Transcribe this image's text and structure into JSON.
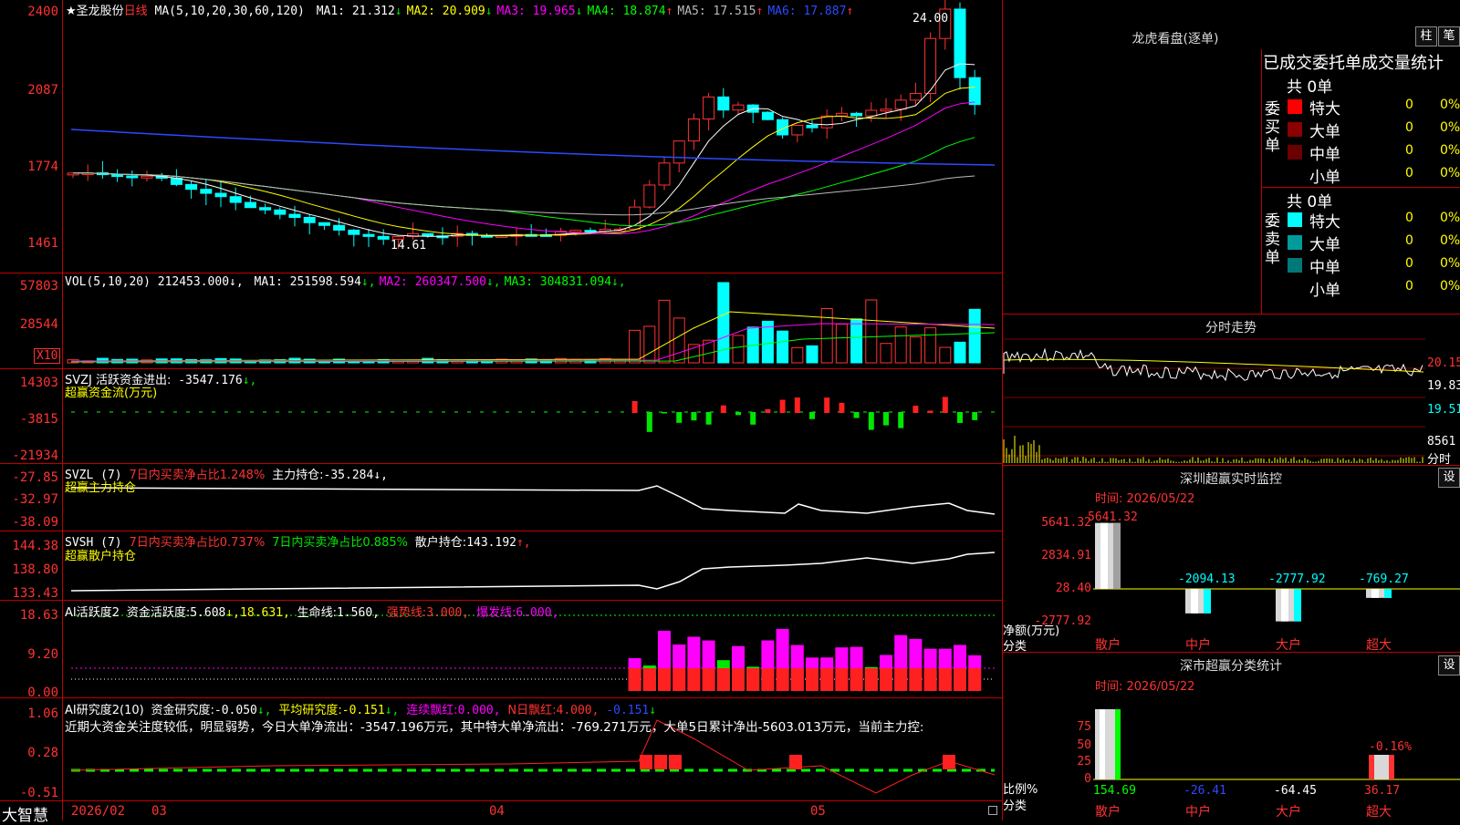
{
  "main_chart": {
    "stock_name": "★圣龙股份",
    "period": "日线",
    "ma_spec": "MA(5,10,20,30,60,120)",
    "ma": [
      {
        "label": "MA1:",
        "value": "21.312",
        "arrow": "↓",
        "color": "#ffffff"
      },
      {
        "label": "MA2:",
        "value": "20.909",
        "arrow": "↓",
        "color": "#ffff00"
      },
      {
        "label": "MA3:",
        "value": "19.965",
        "arrow": "↓",
        "color": "#ff00ff"
      },
      {
        "label": "MA4:",
        "value": "18.874",
        "arrow": "↑",
        "color": "#00ff00"
      },
      {
        "label": "MA5:",
        "value": "17.515",
        "arrow": "↑",
        "color": "#bbbbbb"
      },
      {
        "label": "MA6:",
        "value": "17.887",
        "arrow": "↑",
        "color": "#2b4bff"
      }
    ],
    "y_ticks": [
      "2400",
      "2087",
      "1774",
      "1461"
    ],
    "high_label": "24.00",
    "low_label": "14.61"
  },
  "vol": {
    "spec": "VOL(5,10,20)",
    "value": "212453.000",
    "ma": [
      {
        "label": "MA1:",
        "value": "251598.594",
        "arrow": "↓",
        "color": "#ffffff"
      },
      {
        "label": "MA2:",
        "value": "260347.500",
        "arrow": "↓",
        "color": "#ff00ff"
      },
      {
        "label": "MA3:",
        "value": "304831.094",
        "arrow": "↓",
        "color": "#00ff00"
      }
    ],
    "y_ticks": [
      "57803",
      "28544"
    ],
    "unit": "X10"
  },
  "svzj": {
    "title": "SVZJ  活跃资金进出:",
    "value": "-3547.176",
    "arrow": "↓,",
    "subtitle": "超赢资金流(万元)",
    "y_ticks": [
      "14303",
      "-3815",
      "-21934"
    ]
  },
  "svzl": {
    "title": "SVZL (7)",
    "ratio_label": "7日内买卖净占比1.248%",
    "hold_label": "主力持仓:",
    "hold_value": "-35.284",
    "arrow": "↓,",
    "subtitle": "超赢主力持仓",
    "y_ticks": [
      "-27.85",
      "-32.97",
      "-38.09"
    ]
  },
  "svsh": {
    "title": "SVSH (7)",
    "ratio1": "7日内买卖净占比0.737%",
    "ratio2": "7日内买卖净占比0.885%",
    "hold_label": "散户持仓:",
    "hold_value": "143.192",
    "arrow": "↑,",
    "subtitle": "超赢散户持仓",
    "y_ticks": [
      "144.38",
      "138.80",
      "133.43"
    ]
  },
  "ai_active": {
    "title": "AI活跃度2",
    "label1": "资金活跃度:",
    "value1": "5.608",
    "value2": "↓,18.631,",
    "label3": "生命线:",
    "value3": "1.560,",
    "label4": "强势线:",
    "value4": "3.000,",
    "label5": "爆发线:",
    "value5": "6.000,",
    "y_ticks": [
      "18.63",
      "9.20",
      "0.00"
    ]
  },
  "ai_research": {
    "title": "AI研究度2(10)",
    "label1": "资金研究度:",
    "value1": "-0.050",
    "arrow1": "↓,",
    "label2": "平均研究度:",
    "value2": "-0.151",
    "arrow2": "↓,",
    "label3": "连续飘红:",
    "value3": "0.000,",
    "label4": "N日飘红:",
    "value4": "4.000,",
    "value5": "-0.151",
    "arrow5": "↓",
    "summary": "近期大资金关注度较低，明显弱势，今日大单净流出：-3547.196万元，其中特大单净流出：-769.271万元，大单5日累计净出-5603.013万元，当前主力控:",
    "y_ticks": [
      "1.06",
      "0.28",
      "-0.51"
    ]
  },
  "date_axis": {
    "brand": "大智慧",
    "labels": [
      "2026/02",
      "03",
      "04",
      "05"
    ]
  },
  "dragon_tiger": {
    "title": "龙虎看盘(逐单)",
    "btn1": "柱",
    "btn2": "笔",
    "header": "已成交委托单成交量统计",
    "buy_side": "委买单",
    "sell_side": "委卖单",
    "buy_total": "共 0单",
    "sell_total": "共 0单",
    "buy_rows": [
      {
        "name": "特大",
        "count": "0",
        "pct": "0%",
        "color": "#ff0000"
      },
      {
        "name": "大单",
        "count": "0",
        "pct": "0%",
        "color": "#8b0000"
      },
      {
        "name": "中单",
        "count": "0",
        "pct": "0%",
        "color": "#6b0000"
      },
      {
        "name": "小单",
        "count": "0",
        "pct": "0%",
        "color": "#000000"
      }
    ],
    "sell_rows": [
      {
        "name": "特大",
        "count": "0",
        "pct": "0%",
        "color": "#00ffff"
      },
      {
        "name": "大单",
        "count": "0",
        "pct": "0%",
        "color": "#009c9c"
      },
      {
        "name": "中单",
        "count": "0",
        "pct": "0%",
        "color": "#007878"
      },
      {
        "name": "小单",
        "count": "0",
        "pct": "0%",
        "color": "#000000"
      }
    ]
  },
  "intraday": {
    "title": "分时走势",
    "right_ticks": [
      "20.15",
      "19.83",
      "19.51",
      "8561"
    ],
    "unit": "分时"
  },
  "sz_monitor": {
    "title": "深圳超赢实时监控",
    "btn": "设",
    "time_label": "时间: 2026/05/22",
    "y_ticks": [
      "5641.32",
      "2834.91",
      "28.40",
      "-2777.92"
    ],
    "ylabel": "净额(万元)",
    "xlabel": "分类",
    "bars": [
      {
        "name": "散户",
        "value": 5641.32,
        "label": "5641.32"
      },
      {
        "name": "中户",
        "value": -2094.13,
        "label": "-2094.13"
      },
      {
        "name": "大户",
        "value": -2777.92,
        "label": "-2777.92"
      },
      {
        "name": "超大",
        "value": -769.27,
        "label": "-769.27"
      }
    ]
  },
  "sz_class": {
    "title": "深市超赢分类统计",
    "btn": "设",
    "time_label": "时间: 2026/05/22",
    "y_ticks": [
      "75",
      "50",
      "25",
      "0"
    ],
    "ylabel": "比例%",
    "xlabel": "分类",
    "top_label": "-0.16%",
    "bars": [
      {
        "name": "散户",
        "value": 154.69,
        "label": "154.69",
        "color": "#00ff00"
      },
      {
        "name": "中户",
        "value": -26.41,
        "label": "-26.41",
        "color": "#2b4bff"
      },
      {
        "name": "大户",
        "value": -64.45,
        "label": "-64.45",
        "color": "#ffffff"
      },
      {
        "name": "超大",
        "value": 36.17,
        "label": "36.17",
        "color": "#ff3232"
      }
    ]
  }
}
